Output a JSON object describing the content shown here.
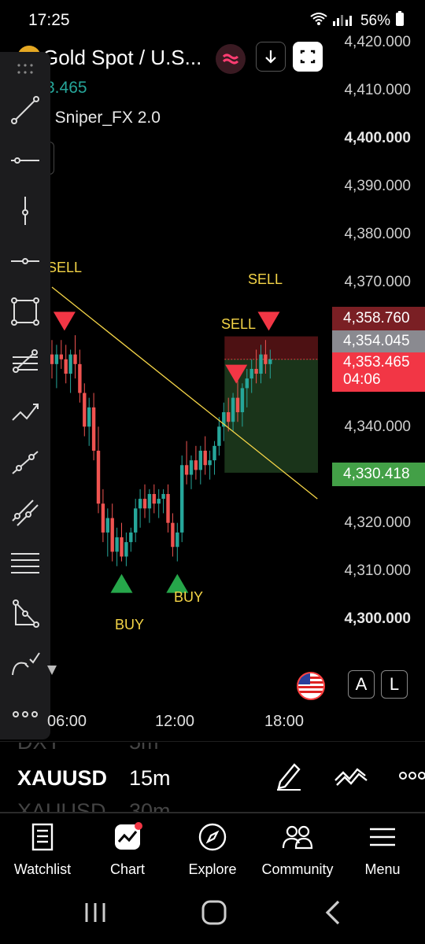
{
  "status_bar": {
    "time": "17:25",
    "battery": "56%"
  },
  "header": {
    "symbol": "Gold Spot / U.S...",
    "price_partial": "3.465",
    "indicator": "] Sniper_FX 2.0"
  },
  "y_axis": {
    "labels": [
      "4,420.000",
      "4,410.000",
      "4,400.000",
      "4,390.000",
      "4,380.000",
      "4,370.000",
      "4,340.000",
      "4,320.000",
      "4,310.000",
      "4,300.000"
    ]
  },
  "price_tags": {
    "high": "4,358.760",
    "bid": "4,354.045",
    "last": "4,353.465",
    "countdown": "04:06",
    "target": "4,330.418"
  },
  "signals": {
    "sell": "SELL",
    "buy": "BUY"
  },
  "chart_controls": {
    "auto": "A",
    "log": "L"
  },
  "x_axis": {
    "labels": [
      "06:00",
      "12:00",
      "18:00"
    ]
  },
  "interval_picker": {
    "above": [
      "DXY",
      "5m"
    ],
    "selected": [
      "XAUUSD",
      "15m"
    ],
    "below": [
      "XAUUSD",
      "30m"
    ]
  },
  "bottom_nav": {
    "items": [
      {
        "label": "Watchlist",
        "icon": "watchlist-icon"
      },
      {
        "label": "Chart",
        "icon": "chart-icon"
      },
      {
        "label": "Explore",
        "icon": "compass-icon"
      },
      {
        "label": "Community",
        "icon": "community-icon"
      },
      {
        "label": "Menu",
        "icon": "menu-icon"
      }
    ]
  },
  "chart_data": {
    "type": "candlestick",
    "symbol": "XAUUSD",
    "interval": "15m",
    "ylim": [
      4295,
      4425
    ],
    "candles": [
      [
        4355,
        4358,
        4350,
        4353
      ],
      [
        4353,
        4357,
        4348,
        4355
      ],
      [
        4355,
        4358,
        4352,
        4354
      ],
      [
        4354,
        4357,
        4349,
        4351
      ],
      [
        4351,
        4356,
        4347,
        4355
      ],
      [
        4355,
        4359,
        4350,
        4353
      ],
      [
        4353,
        4356,
        4345,
        4347
      ],
      [
        4347,
        4349,
        4338,
        4340
      ],
      [
        4340,
        4346,
        4336,
        4344
      ],
      [
        4344,
        4347,
        4333,
        4335
      ],
      [
        4335,
        4340,
        4322,
        4324
      ],
      [
        4324,
        4327,
        4316,
        4318
      ],
      [
        4318,
        4323,
        4313,
        4321
      ],
      [
        4321,
        4324,
        4312,
        4314
      ],
      [
        4314,
        4319,
        4311,
        4317
      ],
      [
        4317,
        4320,
        4312,
        4313
      ],
      [
        4313,
        4318,
        4311,
        4316
      ],
      [
        4316,
        4319,
        4314,
        4318
      ],
      [
        4318,
        4325,
        4316,
        4323
      ],
      [
        4323,
        4327,
        4319,
        4325
      ],
      [
        4325,
        4328,
        4321,
        4323
      ],
      [
        4323,
        4327,
        4320,
        4326
      ],
      [
        4326,
        4328,
        4322,
        4324
      ],
      [
        4324,
        4327,
        4321,
        4325
      ],
      [
        4325,
        4327,
        4322,
        4326
      ],
      [
        4326,
        4328,
        4318,
        4320
      ],
      [
        4320,
        4322,
        4313,
        4315
      ],
      [
        4315,
        4320,
        4312,
        4318
      ],
      [
        4318,
        4334,
        4316,
        4332
      ],
      [
        4332,
        4337,
        4328,
        4330
      ],
      [
        4330,
        4334,
        4327,
        4333
      ],
      [
        4333,
        4336,
        4329,
        4331
      ],
      [
        4331,
        4336,
        4328,
        4335
      ],
      [
        4335,
        4338,
        4330,
        4332
      ],
      [
        4332,
        4335,
        4329,
        4333
      ],
      [
        4333,
        4337,
        4330,
        4336
      ],
      [
        4336,
        4342,
        4334,
        4340
      ],
      [
        4340,
        4345,
        4337,
        4343
      ],
      [
        4343,
        4346,
        4339,
        4341
      ],
      [
        4341,
        4347,
        4339,
        4346
      ],
      [
        4346,
        4350,
        4341,
        4343
      ],
      [
        4343,
        4349,
        4340,
        4348
      ],
      [
        4348,
        4352,
        4344,
        4350
      ],
      [
        4350,
        4354,
        4347,
        4352
      ],
      [
        4352,
        4356,
        4349,
        4351
      ],
      [
        4351,
        4357,
        4349,
        4355
      ],
      [
        4355,
        4358,
        4351,
        4353
      ],
      [
        4353,
        4356,
        4350,
        4354
      ]
    ],
    "signals": [
      {
        "type": "SELL",
        "x_index": 1
      },
      {
        "type": "SELL",
        "x_index": 38
      },
      {
        "type": "SELL",
        "x_index": 45
      },
      {
        "type": "BUY",
        "x_index": 15
      },
      {
        "type": "BUY",
        "x_index": 27
      }
    ],
    "trendline": {
      "start": [
        0,
        4369
      ],
      "end": [
        47,
        4325
      ]
    },
    "position": {
      "entry": 4354.045,
      "stop": 4358.76,
      "target": 4330.418
    }
  }
}
